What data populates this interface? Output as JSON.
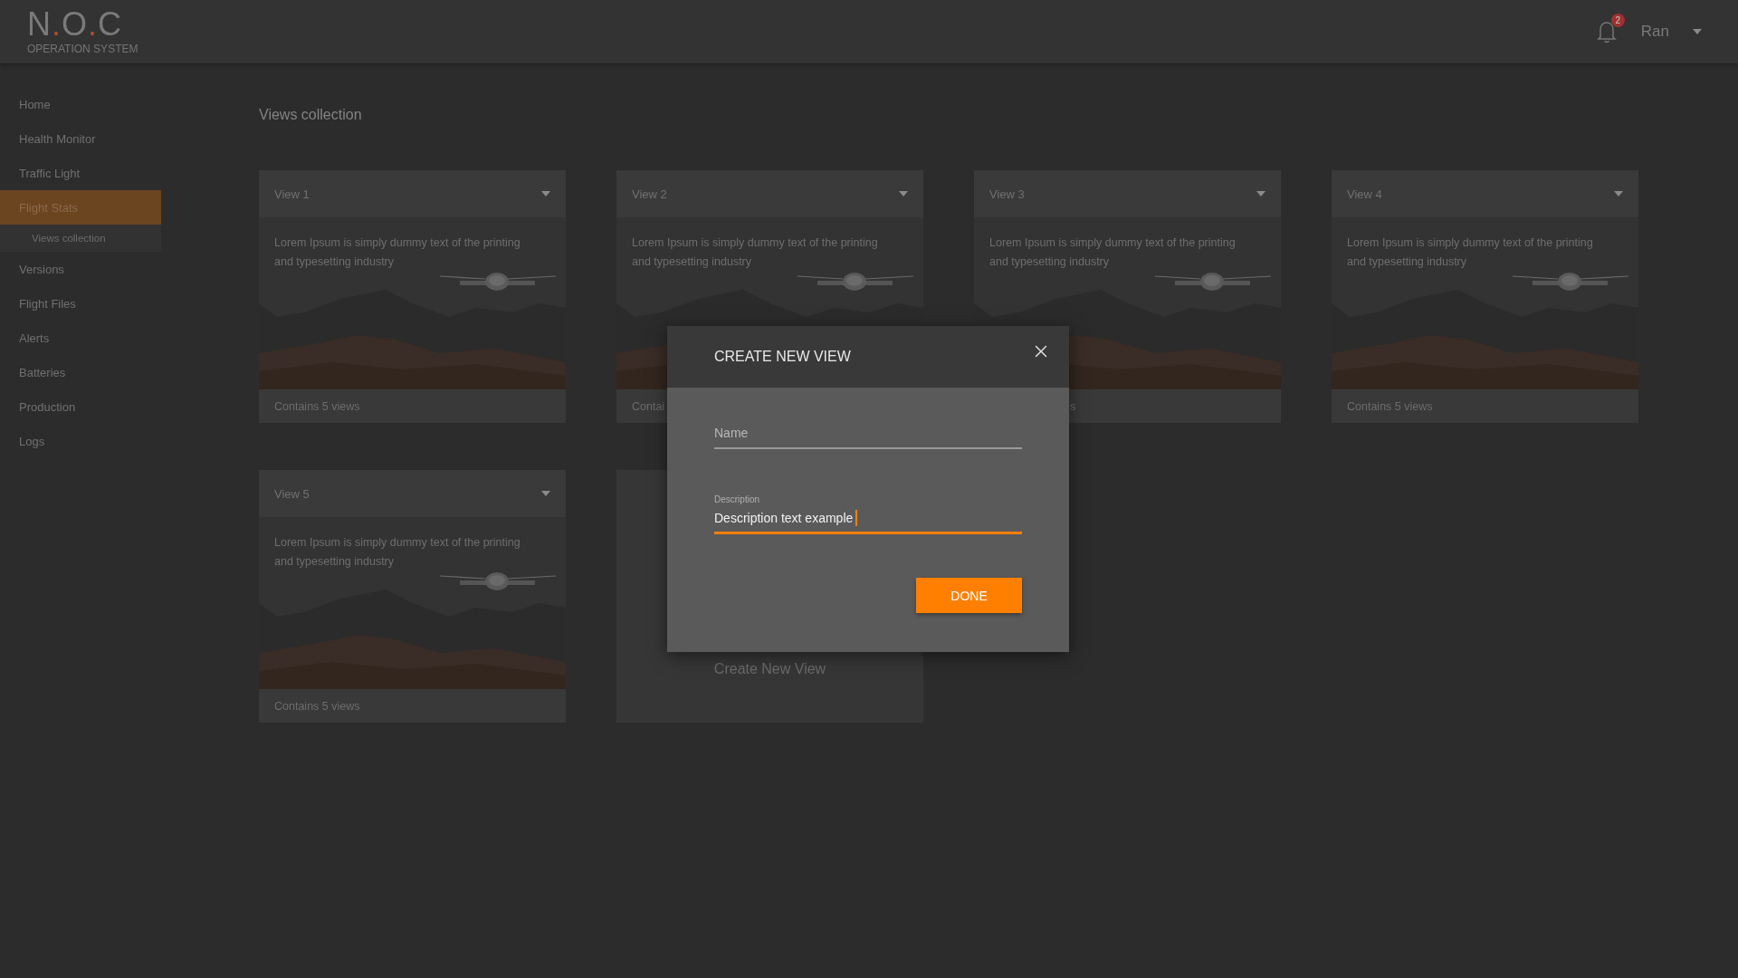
{
  "header": {
    "logo": {
      "letters": [
        "N",
        "O",
        "C"
      ],
      "separator": "."
    },
    "subtitle": "OPERATION SYSTEM",
    "notifications": {
      "count": "2"
    },
    "user": {
      "name": "Ran"
    }
  },
  "sidebar": {
    "items": [
      {
        "label": "Home",
        "selected": false
      },
      {
        "label": "Health Monitor",
        "selected": false
      },
      {
        "label": "Traffic Light",
        "selected": false
      },
      {
        "label": "Flight Stats",
        "selected": true,
        "children": [
          {
            "label": "Views collection",
            "selected": false
          }
        ]
      },
      {
        "label": "Versions",
        "selected": false
      },
      {
        "label": "Flight Files",
        "selected": false
      },
      {
        "label": "Alerts",
        "selected": false
      },
      {
        "label": "Batteries",
        "selected": false
      },
      {
        "label": "Production",
        "selected": false
      },
      {
        "label": "Logs",
        "selected": false
      }
    ]
  },
  "page_title": "Views collection",
  "cards": [
    {
      "kind": "view",
      "title": "View 1",
      "description": "Lorem Ipsum is simply dummy text of the printing and typesetting industry",
      "footer": {
        "text": "Contains 5 views"
      }
    },
    {
      "kind": "view",
      "title": "View 2",
      "description": "Lorem Ipsum is simply dummy text of the printing and typesetting industry",
      "footer": {
        "text": "Contai"
      }
    },
    {
      "kind": "view",
      "title": "View 3",
      "description": "Lorem Ipsum is simply dummy text of the printing and typesetting industry",
      "footer": {
        "text": "s",
        "cut_start": true
      }
    },
    {
      "kind": "view",
      "title": "View 4",
      "description": "Lorem Ipsum is simply dummy text of the printing and typesetting industry",
      "footer": {
        "text": "Contains 5 views"
      }
    },
    {
      "kind": "view",
      "title": "View 5",
      "description": "Lorem Ipsum is simply dummy text of the printing and typesetting industry",
      "footer": {
        "text": "Contains 5 views"
      }
    },
    {
      "kind": "create",
      "label": "Create New View"
    }
  ],
  "dialog": {
    "title": "CREATE NEW VIEW",
    "fields": [
      {
        "placeholder": "Name",
        "focused": false
      },
      {
        "label": "Description",
        "value": "Description text example",
        "focused": true
      }
    ],
    "button": "DONE"
  }
}
